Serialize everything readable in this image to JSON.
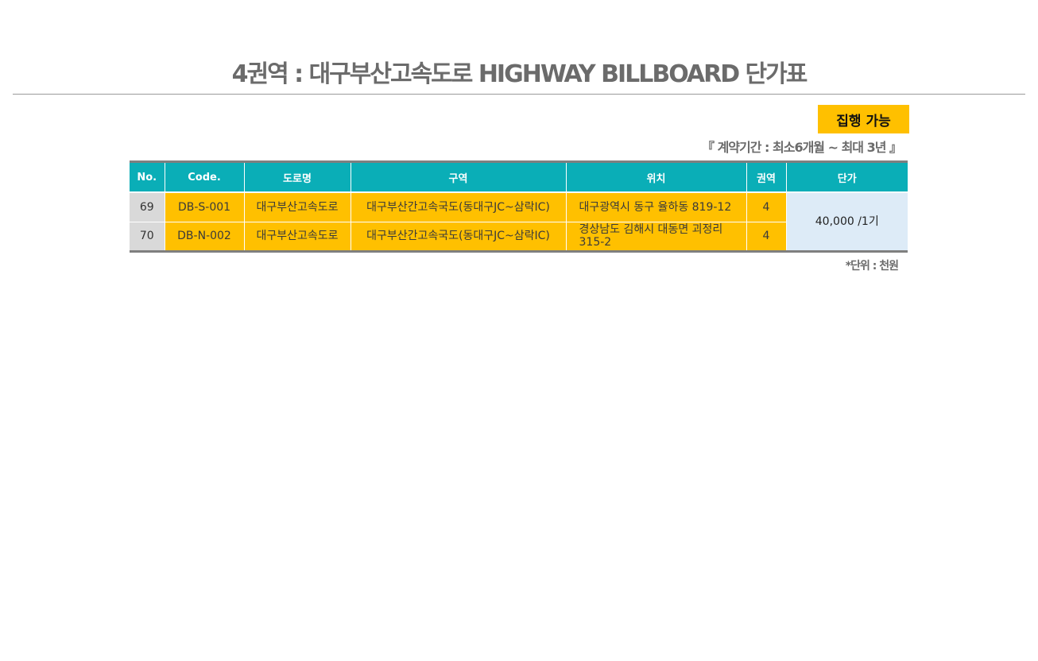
{
  "header": {
    "title": "4권역 : 대구부산고속도로 HIGHWAY BILLBOARD 단가표"
  },
  "status": {
    "badge_label": "집행 가능",
    "badge_color": "#ffc000"
  },
  "contract_period": "『 계약기간 :  최소6개월 ~ 최대 3년 』",
  "table": {
    "columns": [
      "No.",
      "Code.",
      "도로명",
      "구역",
      "위치",
      "권역",
      "단가"
    ],
    "header_color": "#0aaeb7",
    "rows": [
      {
        "no": "69",
        "code": "DB-S-001",
        "road": "대구부산고속도로",
        "section": "대구부산간고속국도(동대구JC~삼락IC)",
        "location": "대구광역시 동구 율하동 819-12",
        "region": "4"
      },
      {
        "no": "70",
        "code": "DB-N-002",
        "road": "대구부산고속도로",
        "section": "대구부산간고속국도(동대구JC~삼락IC)",
        "location": "경상남도 김해시 대동면 괴정리 315-2",
        "region": "4"
      }
    ],
    "price": "40,000 /1기",
    "price_color": "#ddebf7"
  },
  "unit_note": "*단위 : 천원"
}
